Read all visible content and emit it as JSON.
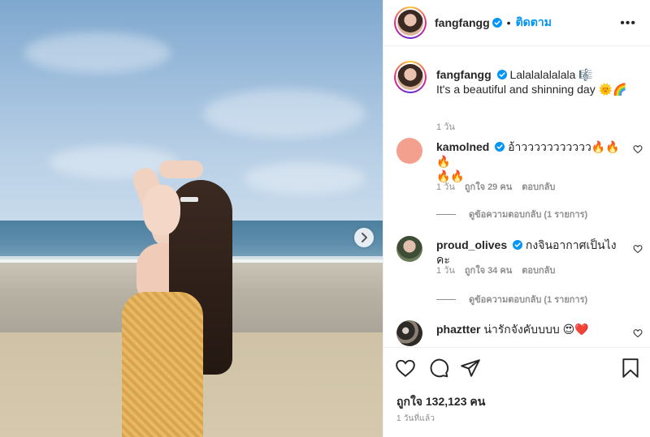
{
  "post": {
    "username": "fangfangg",
    "follow_label": "ติดตาม",
    "separator": "•",
    "more_label": "•••",
    "caption_line1": "Lalalalalalala 🎼",
    "caption_line2": "It's a beautiful and shinning day 🌞🌈",
    "caption_time": "1 วัน",
    "likes": "ถูกใจ 132,123 คน",
    "posted_time": "1 วันที่แล้ว"
  },
  "comments": [
    {
      "username": "kamolned",
      "verified": true,
      "text_line1": "อ้าววววววววววว🔥🔥🔥",
      "text_line2": "🔥🔥",
      "time": "1 วัน",
      "likes": "ถูกใจ 29 คน",
      "reply": "ตอบกลับ",
      "view_replies": "ดูข้อความตอบกลับ (1 รายการ)",
      "avatar_color": "#f3a08e"
    },
    {
      "username": "proud_olives",
      "verified": true,
      "text_line1": "กงจินอากาศเป็นไงคะ",
      "time": "1 วัน",
      "likes": "ถูกใจ 34 คน",
      "reply": "ตอบกลับ",
      "view_replies": "ดูข้อความตอบกลับ (1 รายการ)",
      "avatar_color": "#5a6b4e"
    },
    {
      "username": "phaztter",
      "verified": false,
      "text_line1": "น่ารักจังคับบบบ 😍❤️",
      "avatar_color": "#2e2a28"
    }
  ],
  "colors": {
    "accent": "#0095f6",
    "text": "#262626",
    "muted": "#8e8e8e",
    "border": "#efefef"
  },
  "icons": [
    "verified-icon",
    "heart-icon",
    "comment-icon",
    "share-icon",
    "bookmark-icon",
    "chevron-right-icon",
    "more-icon"
  ]
}
